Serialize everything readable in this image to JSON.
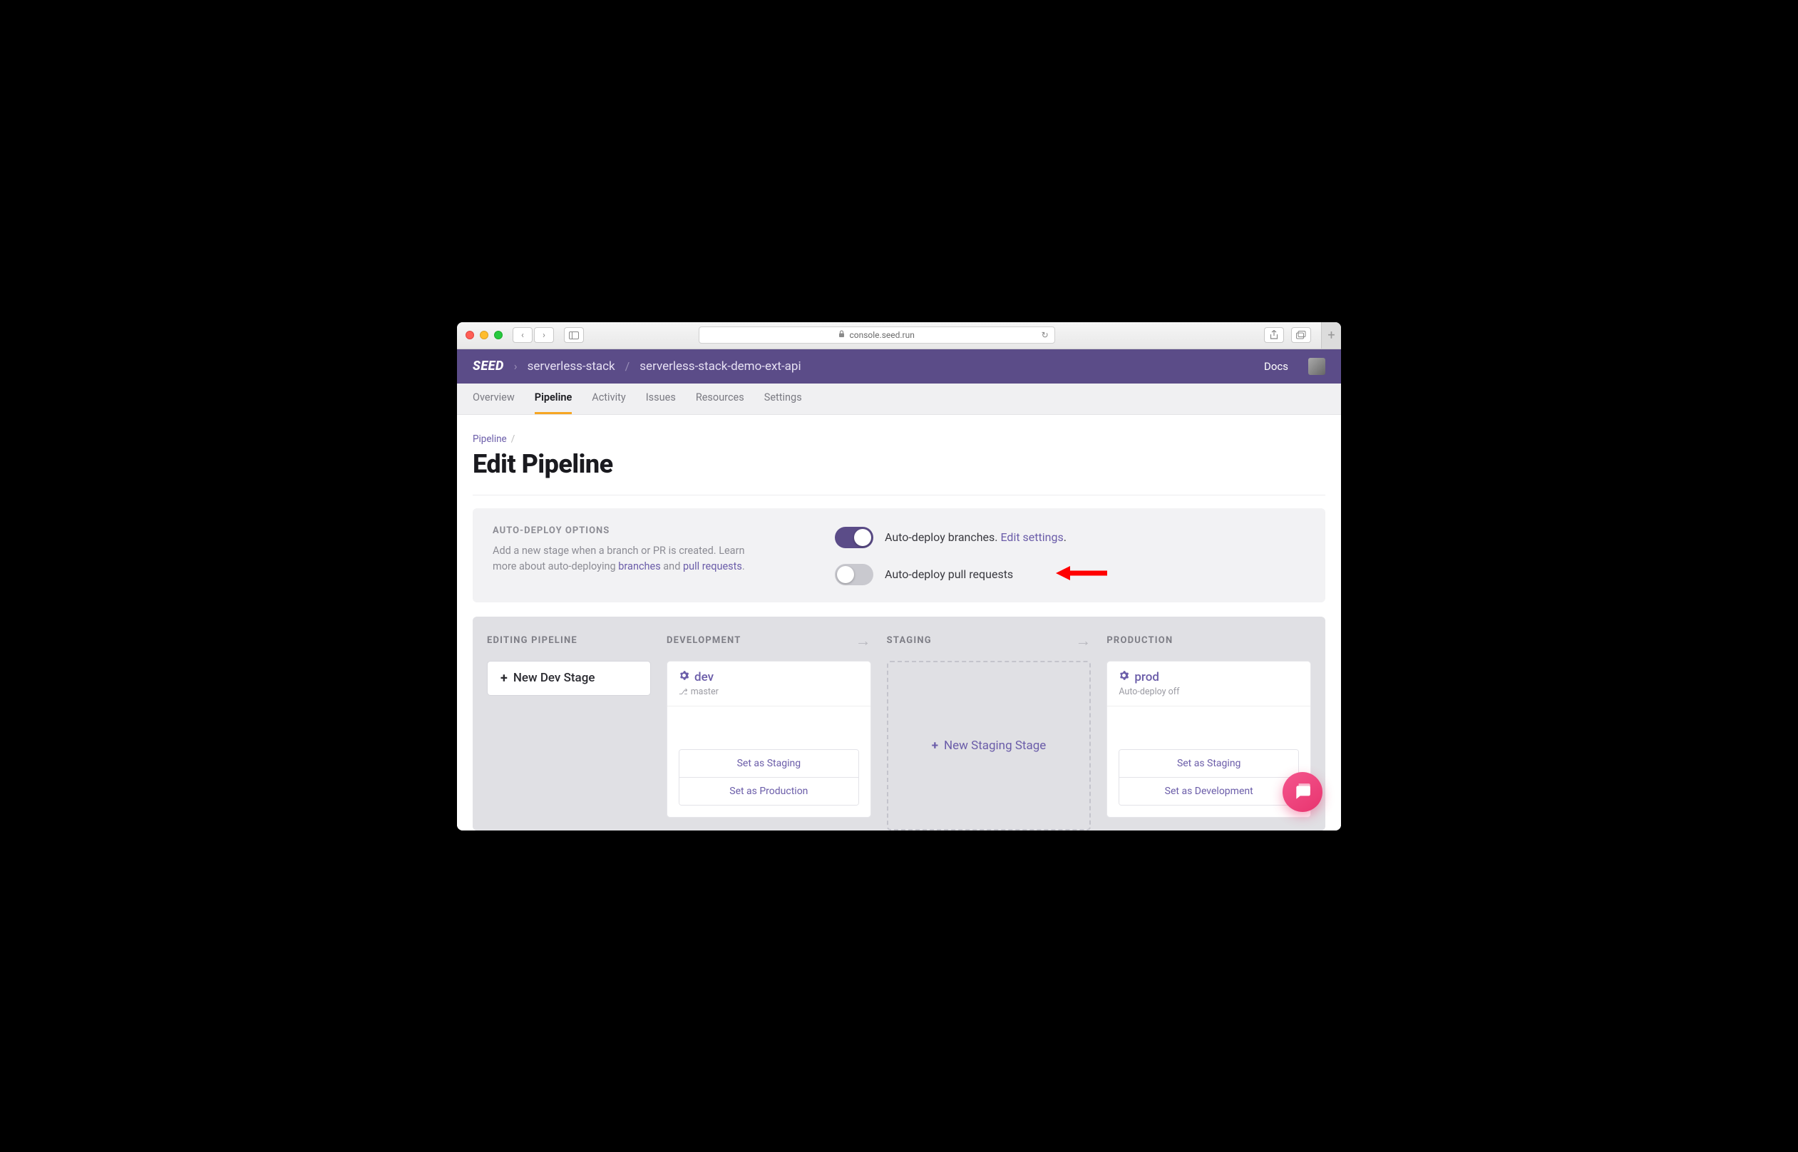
{
  "browser": {
    "url_host": "console.seed.run"
  },
  "header": {
    "logo": "SEED",
    "org": "serverless-stack",
    "project": "serverless-stack-demo-ext-api",
    "docs": "Docs"
  },
  "tabs": {
    "overview": "Overview",
    "pipeline": "Pipeline",
    "activity": "Activity",
    "issues": "Issues",
    "resources": "Resources",
    "settings": "Settings"
  },
  "breadcrumb": {
    "pipeline": "Pipeline"
  },
  "page_title": "Edit Pipeline",
  "autodeploy": {
    "title": "AUTO-DEPLOY OPTIONS",
    "desc_line1": "Add a new stage when a branch or PR is created.",
    "desc_line2_pre": "Learn more about auto-deploying ",
    "link_branches": "branches",
    "desc_and": " and ",
    "link_prs": "pull requests",
    "period": ".",
    "toggle1_label_pre": "Auto-deploy branches. ",
    "toggle1_link": "Edit settings",
    "toggle1_label_post": ".",
    "toggle2_label": "Auto-deploy pull requests"
  },
  "board": {
    "editing_title": "EDITING PIPELINE",
    "new_dev_stage": "New Dev Stage",
    "development_title": "DEVELOPMENT",
    "staging_title": "STAGING",
    "production_title": "PRODUCTION",
    "new_staging_stage": "New Staging Stage",
    "dev_stage": {
      "name": "dev",
      "branch": "master",
      "set_staging": "Set as Staging",
      "set_production": "Set as Production"
    },
    "prod_stage": {
      "name": "prod",
      "sub": "Auto-deploy off",
      "set_staging": "Set as Staging",
      "set_development": "Set as Development"
    }
  }
}
